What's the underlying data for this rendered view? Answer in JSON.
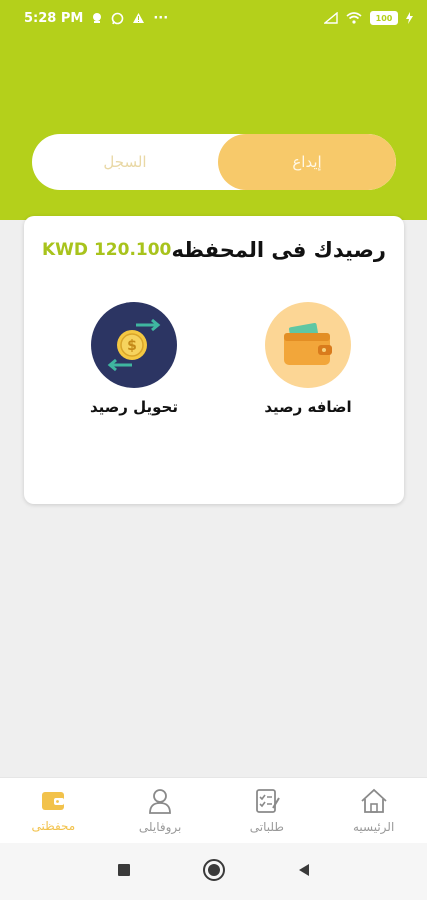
{
  "status_bar": {
    "time": "5:28 PM",
    "dots": "···",
    "battery": "100"
  },
  "tabs": {
    "history_label": "السجل",
    "deposit_label": "إيداع"
  },
  "wallet": {
    "title": "رصيدك فى المحفظه",
    "amount": "KWD 120.100",
    "add_balance_label": "اضافه رصيد",
    "transfer_balance_label": "تحويل رصيد"
  },
  "bottom_nav": {
    "wallet_label": "محفظتى",
    "profile_label": "بروفايلى",
    "orders_label": "طلباتى",
    "home_label": "الرئيسيه"
  },
  "colors": {
    "brand": "#b4d01b",
    "accent": "#f7c96a",
    "navy": "#2c3563",
    "active_nav": "#f2c24b"
  },
  "icons": {
    "add_balance": "wallet-icon",
    "transfer_balance": "coin-transfer-icon",
    "nav_wallet": "wallet-icon",
    "nav_profile": "user-icon",
    "nav_orders": "clipboard-icon",
    "nav_home": "home-icon"
  }
}
